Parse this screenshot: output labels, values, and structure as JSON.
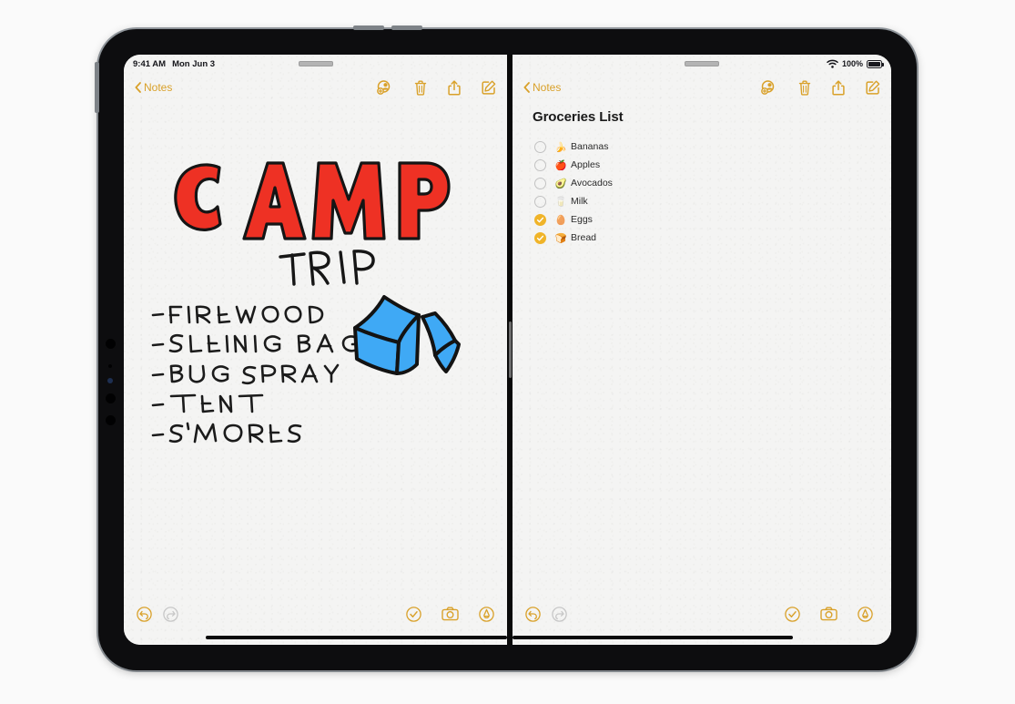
{
  "device": {
    "name": "iPad Pro",
    "orientation": "landscape"
  },
  "status_bar": {
    "time": "9:41 AM",
    "date": "Mon Jun 3",
    "battery_percent": "100%",
    "wifi_icon": "wifi-icon",
    "battery_icon": "battery-full-icon",
    "grabber_icon": "multitasking-grabber"
  },
  "accent_color": "#d9a12a",
  "check_color": "#f0b429",
  "paper_color": "#f4f4f3",
  "left_pane": {
    "back_label": "Notes",
    "toolbar": [
      {
        "name": "collaborate-icon",
        "label": "Share Note"
      },
      {
        "name": "trash-icon",
        "label": "Delete"
      },
      {
        "name": "share-icon",
        "label": "Share"
      },
      {
        "name": "compose-icon",
        "label": "New Note"
      }
    ],
    "drawing": {
      "title": "CAMP",
      "title_color": "#ee3124",
      "subtitle": "TRIP",
      "subtitle_color": "#1a1a1a",
      "tent_icon": "tent-drawing",
      "tent_color": "#3fa9f5",
      "items": [
        "FIREWOOD",
        "SLEEPING BAG",
        "BUG SPRAY",
        "TENT",
        "S'MORES"
      ]
    },
    "bottom_toolbar": {
      "undo": {
        "name": "undo-icon",
        "enabled": "true"
      },
      "redo": {
        "name": "redo-icon",
        "enabled": "false"
      },
      "checklist": {
        "name": "checklist-icon"
      },
      "camera": {
        "name": "camera-icon"
      },
      "markup": {
        "name": "markup-pen-icon"
      }
    }
  },
  "right_pane": {
    "back_label": "Notes",
    "toolbar": [
      {
        "name": "collaborate-icon",
        "label": "Share Note"
      },
      {
        "name": "trash-icon",
        "label": "Delete"
      },
      {
        "name": "share-icon",
        "label": "Share"
      },
      {
        "name": "compose-icon",
        "label": "New Note"
      }
    ],
    "note_title": "Groceries List",
    "checklist": [
      {
        "emoji": "🍌",
        "label": "Bananas",
        "checked": false
      },
      {
        "emoji": "🍎",
        "label": "Apples",
        "checked": false
      },
      {
        "emoji": "🥑",
        "label": "Avocados",
        "checked": false
      },
      {
        "emoji": "🥛",
        "label": "Milk",
        "checked": false
      },
      {
        "emoji": "🥚",
        "label": "Eggs",
        "checked": true
      },
      {
        "emoji": "🍞",
        "label": "Bread",
        "checked": true
      }
    ],
    "bottom_toolbar": {
      "undo": {
        "name": "undo-icon",
        "enabled": "true"
      },
      "redo": {
        "name": "redo-icon",
        "enabled": "false"
      },
      "checklist": {
        "name": "checklist-icon"
      },
      "camera": {
        "name": "camera-icon"
      },
      "markup": {
        "name": "markup-pen-icon"
      }
    }
  }
}
